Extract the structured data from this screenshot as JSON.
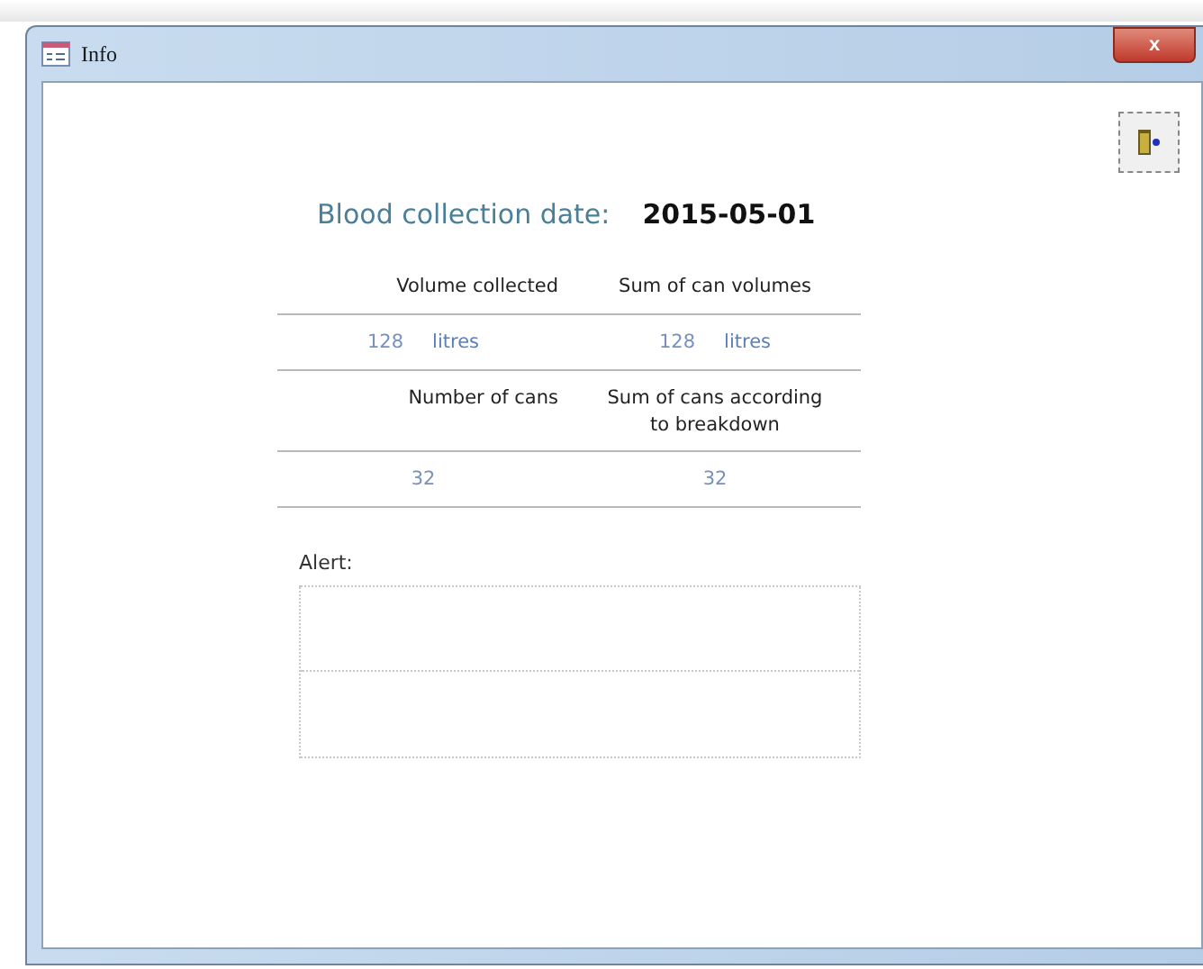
{
  "window": {
    "title": "Info",
    "close_glyph": "x"
  },
  "collection_date": {
    "label": "Blood collection date:",
    "value": "2015-05-01"
  },
  "sections": [
    {
      "headers": [
        [
          "Volume collected"
        ],
        [
          "Sum of can volumes"
        ]
      ],
      "values": [
        {
          "number": "128",
          "unit": "litres"
        },
        {
          "number": "128",
          "unit": "litres"
        }
      ]
    },
    {
      "headers": [
        [
          "Number of cans"
        ],
        [
          "Sum of cans according",
          "to breakdown"
        ]
      ],
      "values": [
        {
          "number": "32"
        },
        {
          "number": "32"
        }
      ]
    }
  ],
  "alert": {
    "label": "Alert:"
  }
}
